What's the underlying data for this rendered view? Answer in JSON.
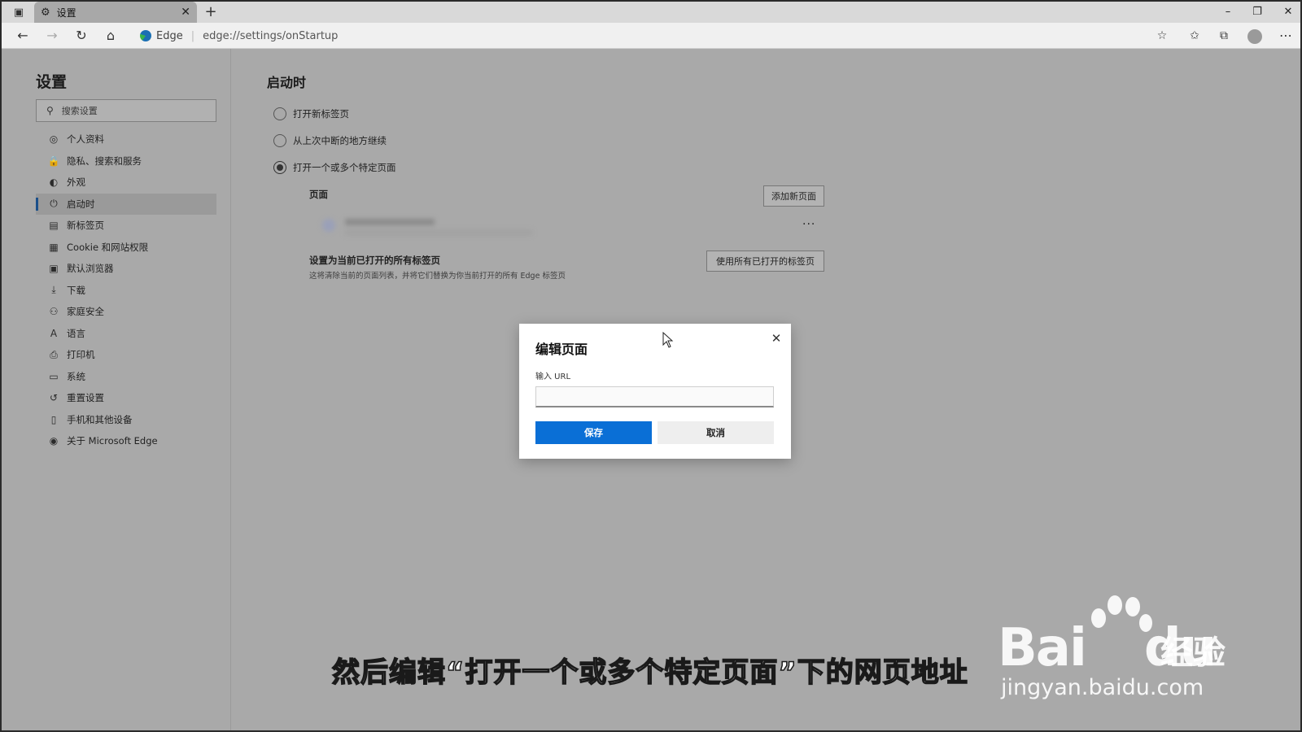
{
  "browser": {
    "tab_title": "设置",
    "new_tab_symbol": "+",
    "tab_close_symbol": "✕",
    "address_label": "Edge",
    "address_separator": "|",
    "url": "edge://settings/onStartup"
  },
  "sidebar": {
    "title": "设置",
    "search_placeholder": "搜索设置",
    "items": [
      {
        "label": "个人资料",
        "icon": "profile-icon",
        "glyph": "◎"
      },
      {
        "label": "隐私、搜索和服务",
        "icon": "lock-icon",
        "glyph": "🔒"
      },
      {
        "label": "外观",
        "icon": "appearance-icon",
        "glyph": "◐"
      },
      {
        "label": "启动时",
        "icon": "power-icon",
        "glyph": "⏻",
        "active": true
      },
      {
        "label": "新标签页",
        "icon": "new-tab-icon",
        "glyph": "▤"
      },
      {
        "label": "Cookie 和网站权限",
        "icon": "cookie-permissions-icon",
        "glyph": "▦"
      },
      {
        "label": "默认浏览器",
        "icon": "default-browser-icon",
        "glyph": "▣"
      },
      {
        "label": "下载",
        "icon": "download-icon",
        "glyph": "⤓"
      },
      {
        "label": "家庭安全",
        "icon": "family-icon",
        "glyph": "⚇"
      },
      {
        "label": "语言",
        "icon": "language-icon",
        "glyph": "A"
      },
      {
        "label": "打印机",
        "icon": "printer-icon",
        "glyph": "⎙"
      },
      {
        "label": "系统",
        "icon": "system-icon",
        "glyph": "▭"
      },
      {
        "label": "重置设置",
        "icon": "reset-icon",
        "glyph": "↺"
      },
      {
        "label": "手机和其他设备",
        "icon": "phone-icon",
        "glyph": "▯"
      },
      {
        "label": "关于 Microsoft Edge",
        "icon": "edge-logo-icon",
        "glyph": "◉"
      }
    ]
  },
  "main": {
    "title": "启动时",
    "options": [
      {
        "label": "打开新标签页",
        "checked": false
      },
      {
        "label": "从上次中断的地方继续",
        "checked": false
      },
      {
        "label": "打开一个或多个特定页面",
        "checked": true
      }
    ],
    "pages_label": "页面",
    "add_page_button": "添加新页面",
    "more_symbol": "···",
    "set_current_title": "设置为当前已打开的所有标签页",
    "set_current_desc": "这将清除当前的页面列表，并将它们替换为你当前打开的所有 Edge 标签页",
    "use_all_tabs_button": "使用所有已打开的标签页"
  },
  "dialog": {
    "title": "编辑页面",
    "url_label": "输入 URL",
    "url_value": "",
    "save_button": "保存",
    "cancel_button": "取消"
  },
  "caption": "然后编辑“打开一个或多个特定页面”下的网页地址",
  "watermark": {
    "brand": "Bai",
    "brand_suffix": "du",
    "product": "经验",
    "domain": "jingyan.baidu.com"
  },
  "colors": {
    "primary_button": "#0a6fd6",
    "overlay_background": "#a9a9a9"
  }
}
